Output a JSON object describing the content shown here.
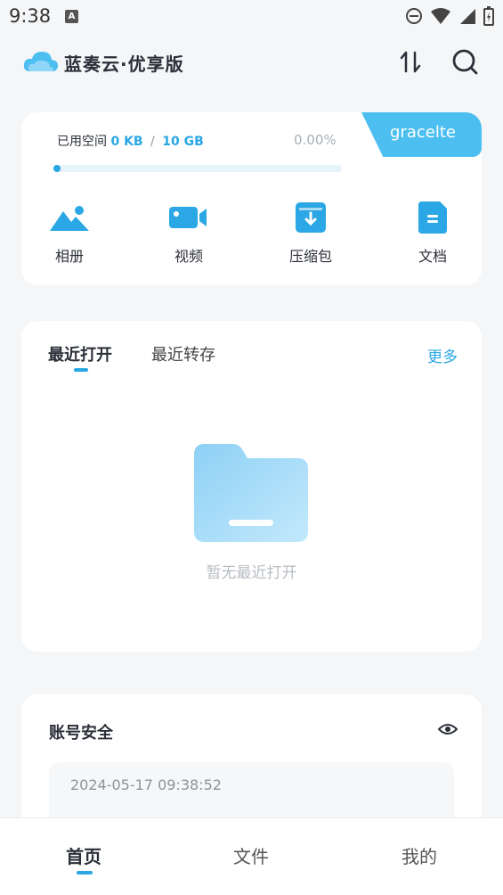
{
  "status_bar": {
    "time": "9:38",
    "notification_icon": "A"
  },
  "header": {
    "title": "蓝奏云·优享版",
    "icons": [
      "cloud-logo-icon",
      "sort-icon",
      "search-icon"
    ]
  },
  "storage": {
    "label": "已用空间",
    "used": "0 KB",
    "separator": "/",
    "total": "10 GB",
    "percent_text": "0.00%",
    "progress": 0.0,
    "username": "gracelte"
  },
  "categories": [
    {
      "label": "相册",
      "icon": "photo-icon"
    },
    {
      "label": "视频",
      "icon": "video-icon"
    },
    {
      "label": "压缩包",
      "icon": "archive-icon"
    },
    {
      "label": "文档",
      "icon": "document-icon"
    }
  ],
  "recent": {
    "tabs": [
      "最近打开",
      "最近转存"
    ],
    "active_tab": 0,
    "more_label": "更多",
    "empty_text": "暂无最近打开"
  },
  "security": {
    "title": "账号安全",
    "log_time": "2024-05-17 09:38:52"
  },
  "bottom_nav": {
    "items": [
      "首页",
      "文件",
      "我的"
    ],
    "active": 0
  },
  "colors": {
    "accent": "#2aa7e4",
    "user_tab": "#4cbff0",
    "empty_folder": "#9fd8f7"
  }
}
